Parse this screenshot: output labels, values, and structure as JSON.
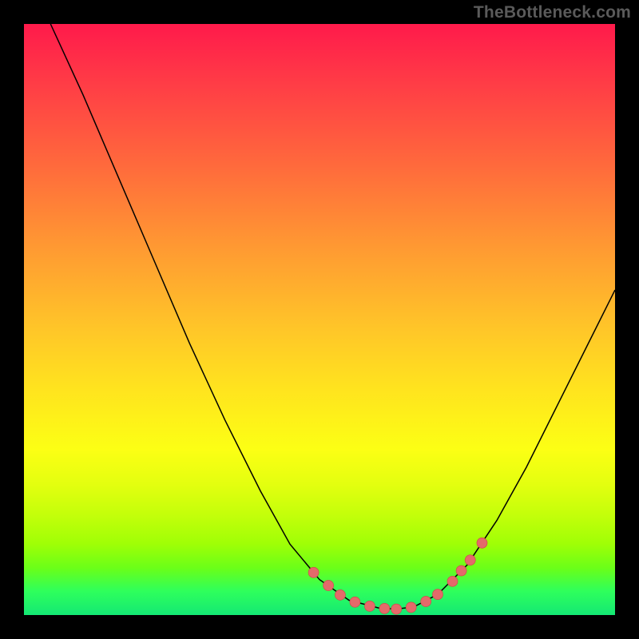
{
  "attribution": "TheBottleneck.com",
  "chart_data": {
    "type": "line",
    "title": "",
    "xlabel": "",
    "ylabel": "",
    "xlim": [
      0,
      100
    ],
    "ylim": [
      0,
      100
    ],
    "grid": false,
    "curve": [
      {
        "x": 4.5,
        "y": 100
      },
      {
        "x": 10,
        "y": 88
      },
      {
        "x": 16,
        "y": 74
      },
      {
        "x": 22,
        "y": 60
      },
      {
        "x": 28,
        "y": 46
      },
      {
        "x": 34,
        "y": 33
      },
      {
        "x": 40,
        "y": 21
      },
      {
        "x": 45,
        "y": 12
      },
      {
        "x": 50,
        "y": 6
      },
      {
        "x": 55,
        "y": 2.5
      },
      {
        "x": 60,
        "y": 1.2
      },
      {
        "x": 63,
        "y": 1.0
      },
      {
        "x": 66,
        "y": 1.4
      },
      {
        "x": 70,
        "y": 3.5
      },
      {
        "x": 75,
        "y": 8.5
      },
      {
        "x": 80,
        "y": 16
      },
      {
        "x": 85,
        "y": 25
      },
      {
        "x": 90,
        "y": 35
      },
      {
        "x": 95,
        "y": 45
      },
      {
        "x": 100,
        "y": 55
      }
    ],
    "markers": [
      {
        "x": 49,
        "y": 7.2
      },
      {
        "x": 51.5,
        "y": 5.0
      },
      {
        "x": 53.5,
        "y": 3.4
      },
      {
        "x": 56,
        "y": 2.2
      },
      {
        "x": 58.5,
        "y": 1.5
      },
      {
        "x": 61,
        "y": 1.1
      },
      {
        "x": 63,
        "y": 1.0
      },
      {
        "x": 65.5,
        "y": 1.3
      },
      {
        "x": 68,
        "y": 2.3
      },
      {
        "x": 70,
        "y": 3.5
      },
      {
        "x": 72.5,
        "y": 5.7
      },
      {
        "x": 74,
        "y": 7.5
      },
      {
        "x": 75.5,
        "y": 9.3
      },
      {
        "x": 77.5,
        "y": 12.2
      }
    ]
  }
}
